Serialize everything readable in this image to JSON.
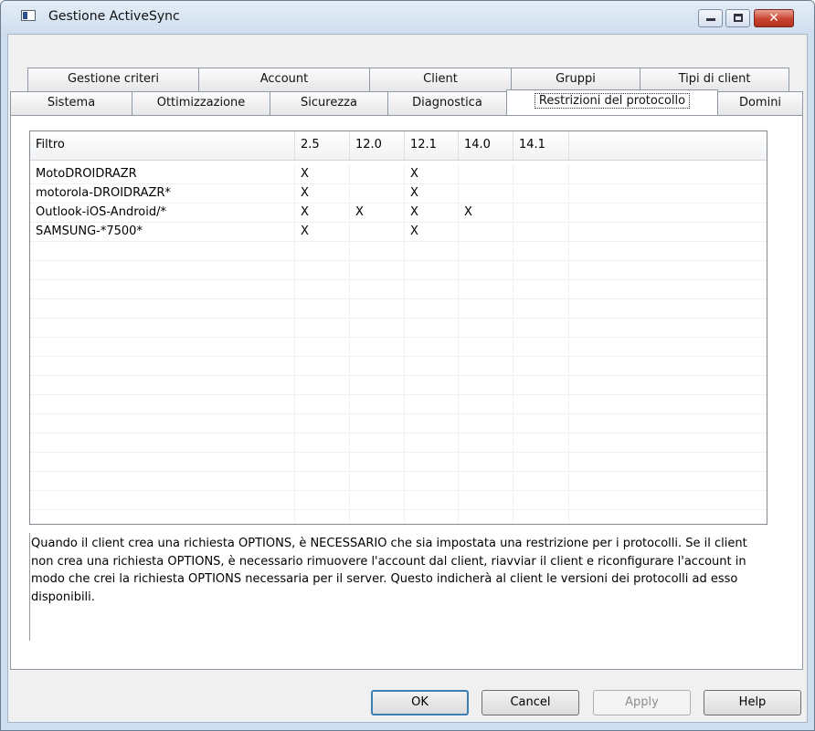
{
  "window": {
    "title": "Gestione ActiveSync"
  },
  "caption_buttons": {
    "minimize": "—",
    "maximize": "□",
    "close": "✕"
  },
  "tabs_row1": [
    "Gestione criteri",
    "Account",
    "Client",
    "Gruppi",
    "Tipi di client"
  ],
  "tabs_row2": [
    "Sistema",
    "Ottimizzazione",
    "Sicurezza",
    "Diagnostica",
    "Restrizioni del protocollo",
    "Domini"
  ],
  "active_tab": "Restrizioni del protocollo",
  "table": {
    "columns": [
      "Filtro",
      "2.5",
      "12.0",
      "12.1",
      "14.0",
      "14.1"
    ],
    "rows": [
      [
        "MotoDROIDRAZR",
        "X",
        "",
        "X",
        "",
        ""
      ],
      [
        "motorola-DROIDRAZR*",
        "X",
        "",
        "X",
        "",
        ""
      ],
      [
        "Outlook-iOS-Android/*",
        "X",
        "X",
        "X",
        "X",
        ""
      ],
      [
        "SAMSUNG-*7500*",
        "X",
        "",
        "X",
        "",
        ""
      ]
    ]
  },
  "description": "Quando il client crea una richiesta OPTIONS, è NECESSARIO che sia impostata una restrizione per i protocolli. Se il client non crea una richiesta OPTIONS, è necessario rimuovere l'account dal client, riavviar il client e riconfigurare l'account in modo che crei la richiesta OPTIONS necessaria per il server. Questo indicherà al client le versioni dei protocolli ad esso disponibili.",
  "buttons": {
    "ok": "OK",
    "cancel": "Cancel",
    "apply": "Apply",
    "help": "Help"
  }
}
